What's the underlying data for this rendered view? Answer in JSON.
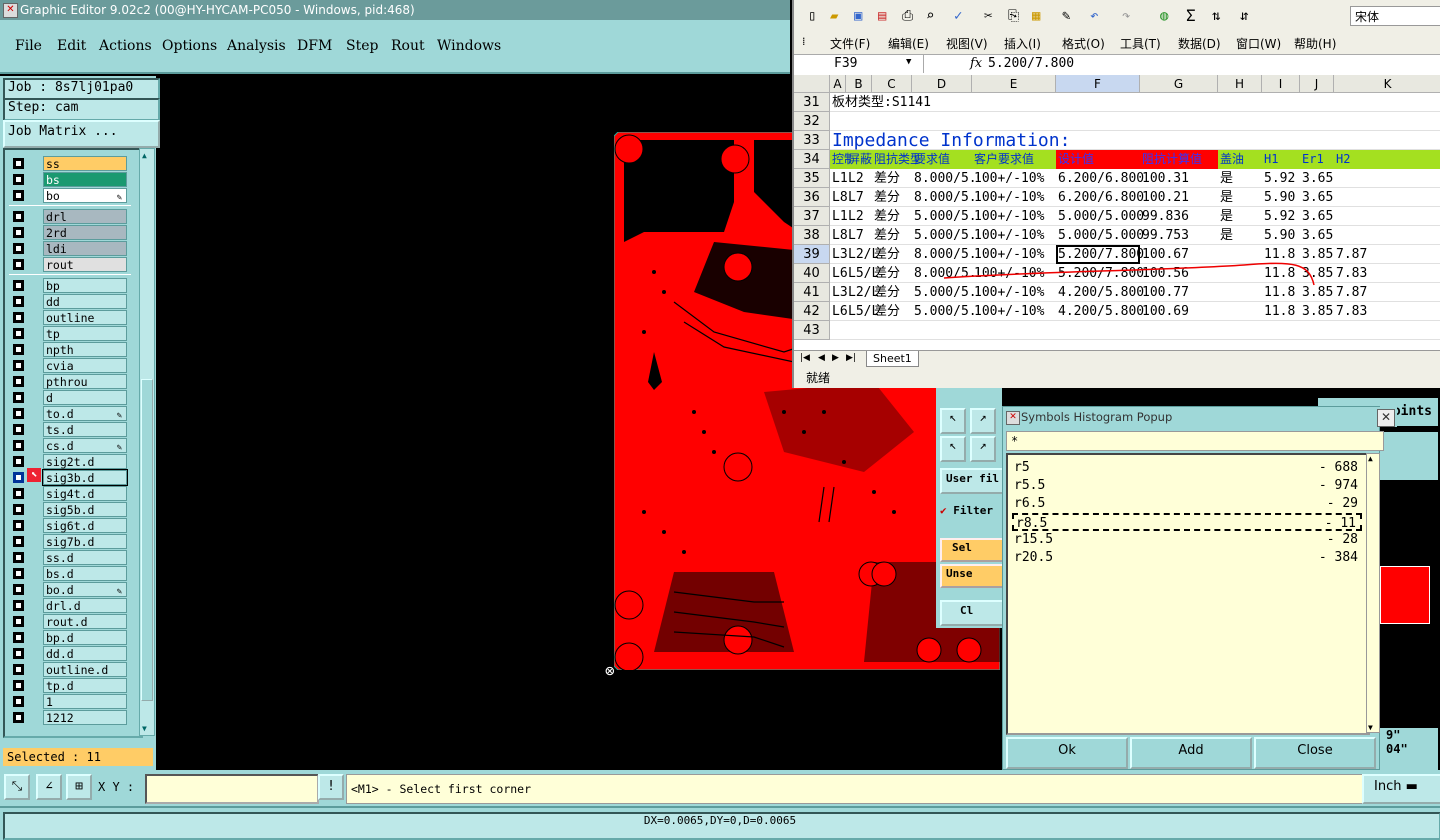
{
  "ge": {
    "title": "Graphic Editor 9.02c2 (00@HY-HYCAM-PC050 - Windows, pid:468)",
    "menu": [
      "File",
      "Edit",
      "Actions",
      "Options",
      "Analysis",
      "DFM",
      "Step",
      "Rout",
      "Windows"
    ],
    "job_label": "Job : 8s7lj01pa0",
    "step_label": "Step: cam",
    "job_matrix": "Job Matrix ...",
    "selected": "Selected : 11",
    "xy_label": "X Y :",
    "prompt": "<M1> - Select first corner",
    "units": "Inch",
    "dx_status": "DX=0.0065,DY=0,D=0.0065",
    "layers": [
      {
        "name": "ss",
        "color": "#ffcc66"
      },
      {
        "name": "bs",
        "color": "#1a9970"
      },
      {
        "name": "bo",
        "color": "#ffffff",
        "mark": true
      },
      {
        "name": "drl",
        "color": "#a8b8c0"
      },
      {
        "name": "2rd",
        "color": "#a8b8c0"
      },
      {
        "name": "ldi",
        "color": "#a8b8c0"
      },
      {
        "name": "rout",
        "color": "#e0e0e0"
      },
      {
        "name": "bp"
      },
      {
        "name": "dd"
      },
      {
        "name": "outline"
      },
      {
        "name": "tp"
      },
      {
        "name": "npth"
      },
      {
        "name": "cvia"
      },
      {
        "name": "pthrou"
      },
      {
        "name": "d"
      },
      {
        "name": "to.d",
        "mark": true
      },
      {
        "name": "ts.d"
      },
      {
        "name": "cs.d",
        "mark": true
      },
      {
        "name": "sig2t.d"
      },
      {
        "name": "sig3b.d",
        "active": true
      },
      {
        "name": "sig4t.d"
      },
      {
        "name": "sig5b.d"
      },
      {
        "name": "sig6t.d"
      },
      {
        "name": "sig7b.d"
      },
      {
        "name": "ss.d"
      },
      {
        "name": "bs.d"
      },
      {
        "name": "bo.d",
        "mark": true
      },
      {
        "name": "drl.d"
      },
      {
        "name": "rout.d"
      },
      {
        "name": "bp.d"
      },
      {
        "name": "dd.d"
      },
      {
        "name": "outline.d"
      },
      {
        "name": "tp.d"
      },
      {
        "name": "1"
      },
      {
        "name": "1212"
      }
    ]
  },
  "excel": {
    "menu": [
      "文件(F)",
      "编辑(E)",
      "视图(V)",
      "插入(I)",
      "格式(O)",
      "工具(T)",
      "数据(D)",
      "窗口(W)",
      "帮助(H)"
    ],
    "font": "宋体",
    "namebox": "F39",
    "formula": "5.200/7.800",
    "columns": [
      "A",
      "B",
      "C",
      "D",
      "E",
      "F",
      "G",
      "H",
      "I",
      "J",
      "K"
    ],
    "rows": [
      {
        "num": "31",
        "cells": [
          "板材类型:S1141"
        ]
      },
      {
        "num": "32",
        "cells": []
      },
      {
        "num": "33",
        "cells": [
          "Impedance Information:"
        ]
      },
      {
        "num": "34",
        "cells": [
          "控制",
          "屏蔽",
          "阻抗类型",
          "要求值",
          "客户要求值",
          "设计值",
          "阻抗计算值",
          "盖油",
          "H1",
          "Er1",
          "H2"
        ]
      },
      {
        "num": "35",
        "cells": [
          "L1",
          "L2",
          "差分",
          "8.000/5.000",
          "100+/-10%",
          "6.200/6.800",
          "100.31",
          "是",
          "5.92",
          "3.65",
          ""
        ]
      },
      {
        "num": "36",
        "cells": [
          "L8",
          "L7",
          "差分",
          "8.000/5.000",
          "100+/-10%",
          "6.200/6.800",
          "100.21",
          "是",
          "5.90",
          "3.65",
          ""
        ]
      },
      {
        "num": "37",
        "cells": [
          "L1",
          "L2",
          "差分",
          "5.000/5.000",
          "100+/-10%",
          "5.000/5.000",
          "99.836",
          "是",
          "5.92",
          "3.65",
          ""
        ]
      },
      {
        "num": "38",
        "cells": [
          "L8",
          "L7",
          "差分",
          "5.000/5.000",
          "100+/-10%",
          "5.000/5.000",
          "99.753",
          "是",
          "5.90",
          "3.65",
          ""
        ]
      },
      {
        "num": "39",
        "cells": [
          "L3",
          "L2/L4",
          "差分",
          "8.000/5.000",
          "100+/-10%",
          "5.200/7.800",
          "100.67",
          "",
          "11.8",
          "3.85",
          "7.87"
        ]
      },
      {
        "num": "40",
        "cells": [
          "L6",
          "L5/L7",
          "差分",
          "8.000/5.000",
          "100+/-10%",
          "5.200/7.800",
          "100.56",
          "",
          "11.8",
          "3.85",
          "7.83"
        ]
      },
      {
        "num": "41",
        "cells": [
          "L3",
          "L2/L4",
          "差分",
          "5.000/5.000",
          "100+/-10%",
          "4.200/5.800",
          "100.77",
          "",
          "11.8",
          "3.85",
          "7.87"
        ]
      },
      {
        "num": "42",
        "cells": [
          "L6",
          "L5/L7",
          "差分",
          "5.000/5.000",
          "100+/-10%",
          "4.200/5.800",
          "100.69",
          "",
          "11.8",
          "3.85",
          "7.83"
        ]
      },
      {
        "num": "43",
        "cells": []
      }
    ],
    "sheet": "Sheet1",
    "status": "就绪"
  },
  "mid": {
    "user_filter": "User fil",
    "filter": "Filter",
    "sel": "Sel",
    "unsel": "Unse",
    "cl": "Cl",
    "points": "points",
    "val1": "9\"",
    "val2": "04\""
  },
  "popup": {
    "title": "Symbols Histogram Popup",
    "filter": "*",
    "symbols": [
      {
        "name": "r5",
        "count": "688"
      },
      {
        "name": "r5.5",
        "count": "974"
      },
      {
        "name": "r6.5",
        "count": "29"
      },
      {
        "name": "r8.5",
        "count": "11",
        "selected": true
      },
      {
        "name": "r15.5",
        "count": "28"
      },
      {
        "name": "r20.5",
        "count": "384"
      }
    ],
    "ok": "Ok",
    "add": "Add",
    "close": "Close"
  }
}
